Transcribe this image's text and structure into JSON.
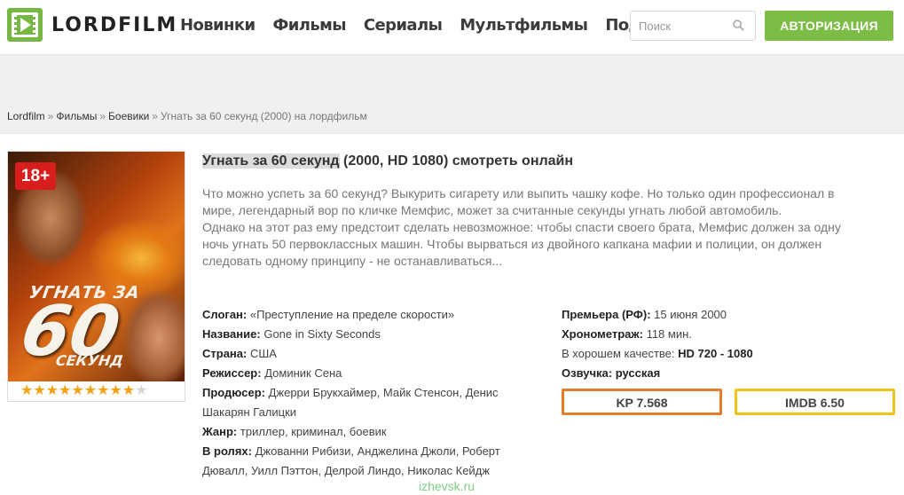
{
  "header": {
    "logo_text": "LORDFILM",
    "nav": [
      "Новинки",
      "Фильмы",
      "Сериалы",
      "Мультфильмы",
      "Подборки"
    ],
    "search_placeholder": "Поиск",
    "auth_label": "АВТОРИЗАЦИЯ"
  },
  "breadcrumb": {
    "items": [
      "Lordfilm",
      "Фильмы",
      "Боевики"
    ],
    "separator": "»",
    "current": "Угнать за 60 секунд (2000) на лордфильм"
  },
  "movie": {
    "title_highlight": "Угнать за 60 секунд",
    "title_rest": " (2000, HD 1080) смотреть онлайн",
    "age_badge": "18+",
    "poster_text": [
      "УГНАТЬ ЗА",
      "60",
      "СЕКУНД"
    ],
    "rating_stars": {
      "filled": 9,
      "total": 10
    },
    "description": [
      "Что можно успеть за 60 секунд? Выкурить сигарету или выпить чашку кофе. Но только один профессионал в мире, легендарный вор по кличке Мемфис, может за считанные секунды угнать любой автомобиль.",
      "Однако на этот раз ему предстоит сделать невозможное: чтобы спасти своего брата, Мемфис должен за одну ночь угнать 50 первоклассных машин. Чтобы вырваться из двойного капкана мафии и полиции, он должен следовать одному принципу - не останавливаться..."
    ],
    "info": [
      {
        "label": "Слоган:",
        "value": "«Преступление на пределе скорости»"
      },
      {
        "label": "Название:",
        "value": "Gone in Sixty Seconds"
      },
      {
        "label": "Страна:",
        "value": "США"
      },
      {
        "label": "Режиссер:",
        "value": "Доминик Сена"
      },
      {
        "label": "Продюсер:",
        "value": "Джерри Брукхаймер, Майк Стенсон, Денис Шакарян Галицки"
      },
      {
        "label": "Жанр:",
        "value": "триллер, криминал, боевик"
      },
      {
        "label": "В ролях:",
        "value": "Джованни Рибизи, Анджелина Джоли, Роберт Дювалл, Уилл Пэттон, Делрой Линдо, Николас Кейдж"
      }
    ],
    "info_right": [
      {
        "label": "Премьера (РФ):",
        "value": "15 июня 2000"
      },
      {
        "label": "Хронометраж:",
        "value": "118 мин."
      },
      {
        "label": "В хорошем качестве:",
        "value": "HD 720 - 1080"
      },
      {
        "label": "Озвучка:",
        "value": "русская"
      }
    ],
    "kp_rating": "KP 7.568",
    "imdb_rating": "IMDB 6.50"
  },
  "watermark": "izhevsk.ru",
  "colors": {
    "accent": "#7cbd46",
    "kp_border": "#e57c2b",
    "imdb_border": "#f0c419",
    "age_badge": "#d81d1d"
  }
}
